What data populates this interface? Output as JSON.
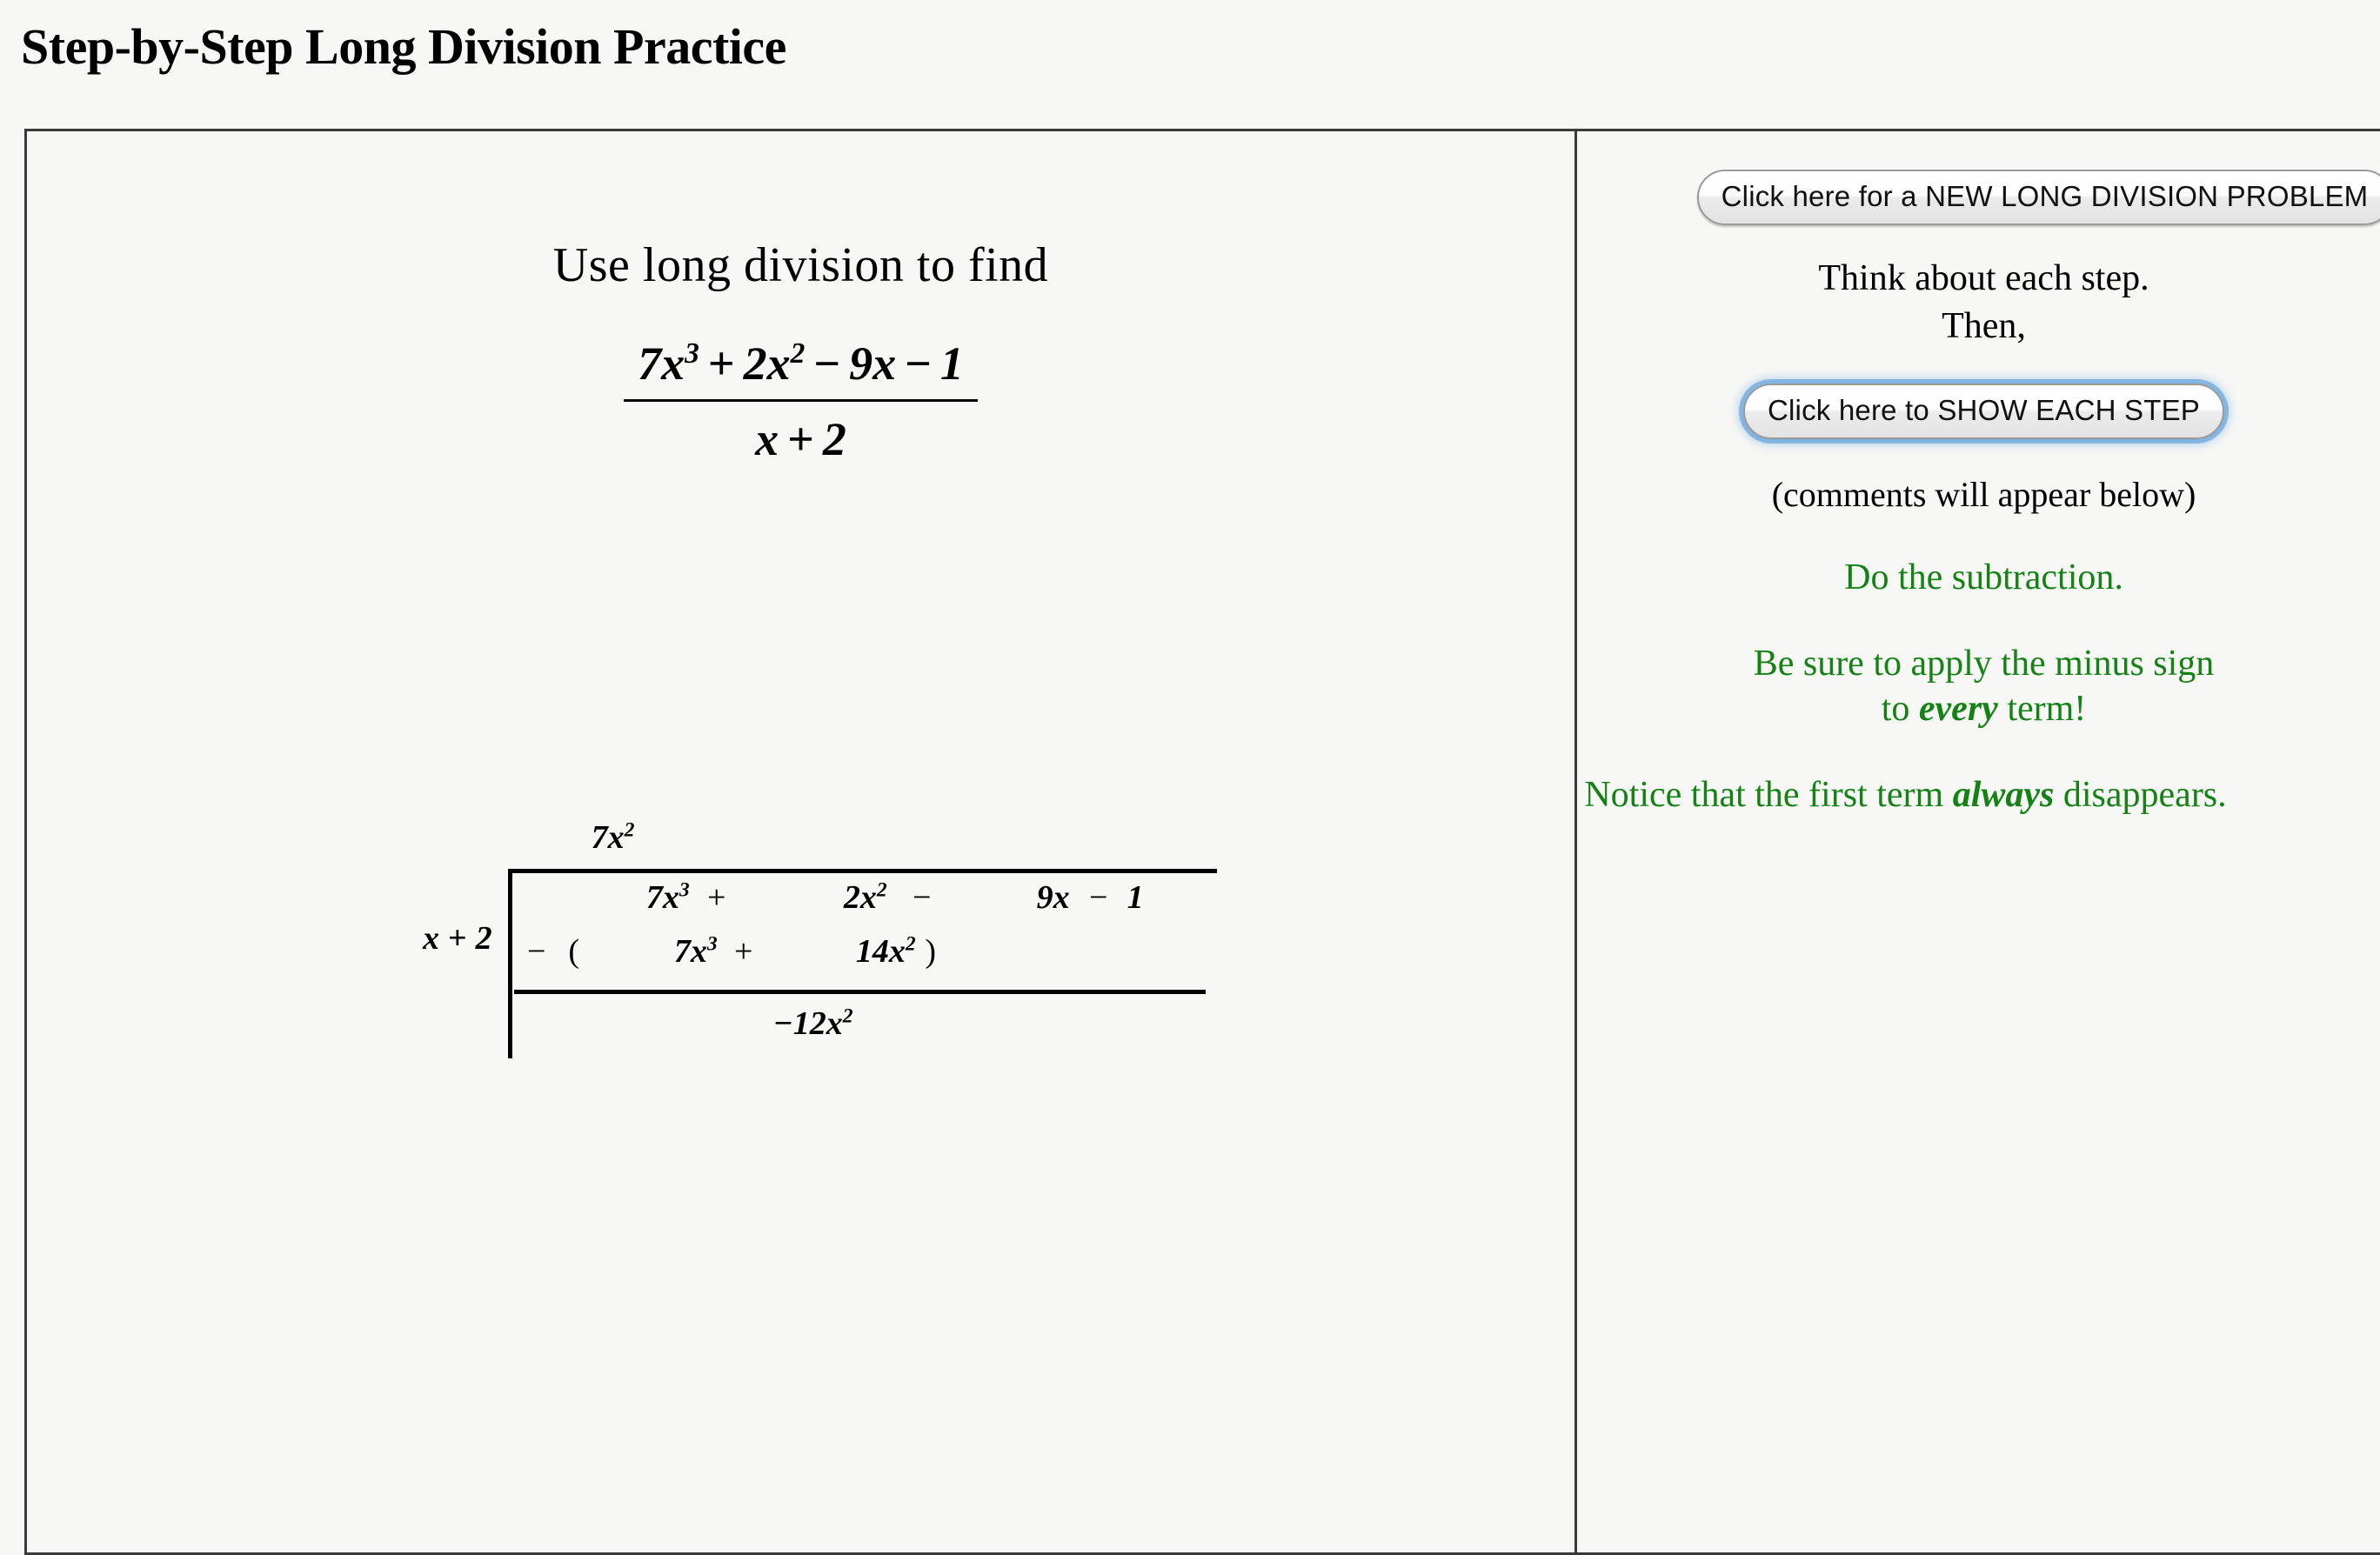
{
  "page": {
    "title": "Step-by-Step Long Division Practice"
  },
  "left_panel": {
    "prompt": "Use long division to find",
    "fraction": {
      "numerator": "7x3 + 2x2 − 9x − 1",
      "numerator_parts": {
        "t1_coef": "7",
        "t1_var": "x",
        "t1_exp": "3",
        "op1": "+",
        "t2_coef": "2",
        "t2_var": "x",
        "t2_exp": "2",
        "op2": "−",
        "t3_coef": "9",
        "t3_var": "x",
        "op3": "−",
        "t4": "1"
      },
      "denominator": "x + 2",
      "denominator_parts": {
        "var": "x",
        "op": "+",
        "num": "2"
      }
    },
    "long_division": {
      "quotient": {
        "coef": "7",
        "var": "x",
        "exp": "2"
      },
      "divisor": {
        "var": "x",
        "op": "+",
        "num": "2"
      },
      "dividend": {
        "t1_coef": "7",
        "t1_var": "x",
        "t1_exp": "3",
        "op1": "+",
        "t2_coef": "2",
        "t2_var": "x",
        "t2_exp": "2",
        "op2": "−",
        "t3_coef": "9",
        "t3_var": "x",
        "op3": "−",
        "t4": "1"
      },
      "subtract_line": {
        "minus": "−",
        "paren_open": "(",
        "t1_coef": "7",
        "t1_var": "x",
        "t1_exp": "3",
        "op": "+",
        "t2_coef": "14",
        "t2_var": "x",
        "t2_exp": "2",
        "paren_close": ")"
      },
      "result": {
        "sign": "−",
        "coef": "12",
        "var": "x",
        "exp": "2"
      }
    }
  },
  "right_panel": {
    "new_problem_button": "Click here for a NEW LONG DIVISION PROBLEM",
    "instruction_line1": "Think about each step.",
    "instruction_line2": "Then,",
    "show_step_button": "Click here to SHOW EACH STEP",
    "comments_note": "(comments will appear below)",
    "comments": [
      {
        "text": "Do the subtraction."
      },
      {
        "pre": "Be sure to apply the minus sign",
        "line2_pre": "to ",
        "line2_em": "every",
        "line2_post": " term!"
      },
      {
        "pre": "Notice that the first term ",
        "em": "always",
        "post": " disappears."
      }
    ],
    "colors": {
      "comment_green": "#158215",
      "focus_ring_blue": "#78afe1"
    }
  }
}
